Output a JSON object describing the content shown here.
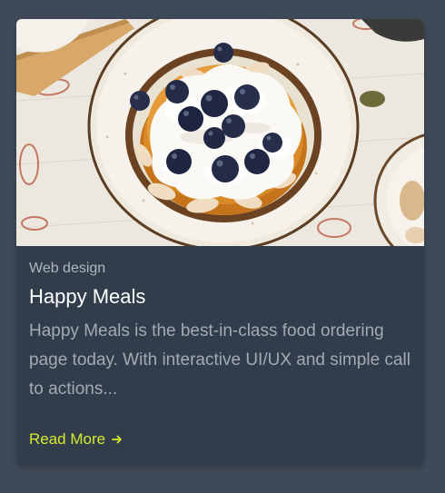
{
  "card": {
    "category": "Web design",
    "title": "Happy Meals",
    "description": "Happy Meals is the best-in-class food ordering page today. With interactive UI/UX and simple call to actions...",
    "read_more_label": "Read More",
    "read_more_icon": "arrow-right-icon",
    "image_alt": "Pancakes with cream and blueberries on a plate"
  },
  "colors": {
    "page_background": "#3f4a59",
    "card_background": "#323d4b",
    "title": "#ffffff",
    "category": "#aeb6c1",
    "description": "#a1aab5",
    "accent": "#d7ea2d"
  }
}
